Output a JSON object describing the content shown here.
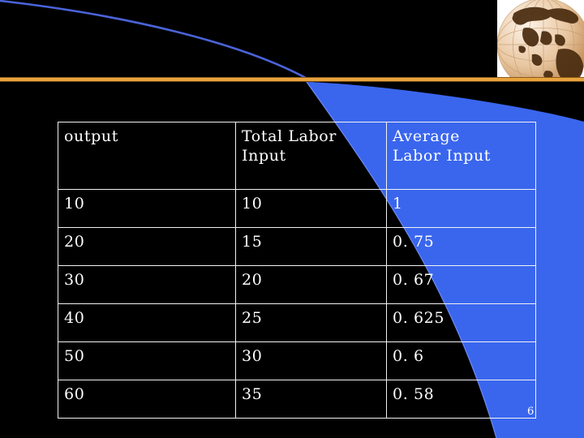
{
  "slide": {
    "page_number": "6",
    "background_color": "#000000",
    "accent_rule_color": "#e8a33d",
    "ribbon_color": "#3a66ee",
    "thin_curve_color": "#4a63d8",
    "table_border_color": "#f2f2f2",
    "text_color": "#ffffff"
  },
  "decor": {
    "globe_panel_name": "globe-image",
    "orange_rule_name": "orange-divider",
    "ribbon_name": "blue-ribbon-swoosh",
    "curve_name": "blue-arc-curve"
  },
  "table": {
    "headers": [
      "output",
      "Total Labor\nInput",
      "Average\nLabor Input"
    ],
    "rows": [
      [
        "10",
        "10",
        "1"
      ],
      [
        "20",
        "15",
        "0. 75"
      ],
      [
        "30",
        "20",
        "0. 67"
      ],
      [
        "40",
        "25",
        "0. 625"
      ],
      [
        "50",
        "30",
        "0. 6"
      ],
      [
        "60",
        "35",
        "0. 58"
      ]
    ]
  },
  "chart_data": {
    "type": "table",
    "title": "",
    "columns": [
      "output",
      "Total Labor Input",
      "Average Labor Input"
    ],
    "rows": [
      {
        "output": 10,
        "total_labor_input": 10,
        "average_labor_input": 1
      },
      {
        "output": 20,
        "total_labor_input": 15,
        "average_labor_input": 0.75
      },
      {
        "output": 30,
        "total_labor_input": 20,
        "average_labor_input": 0.67
      },
      {
        "output": 40,
        "total_labor_input": 25,
        "average_labor_input": 0.625
      },
      {
        "output": 50,
        "total_labor_input": 30,
        "average_labor_input": 0.6
      },
      {
        "output": 60,
        "total_labor_input": 35,
        "average_labor_input": 0.58
      }
    ]
  }
}
